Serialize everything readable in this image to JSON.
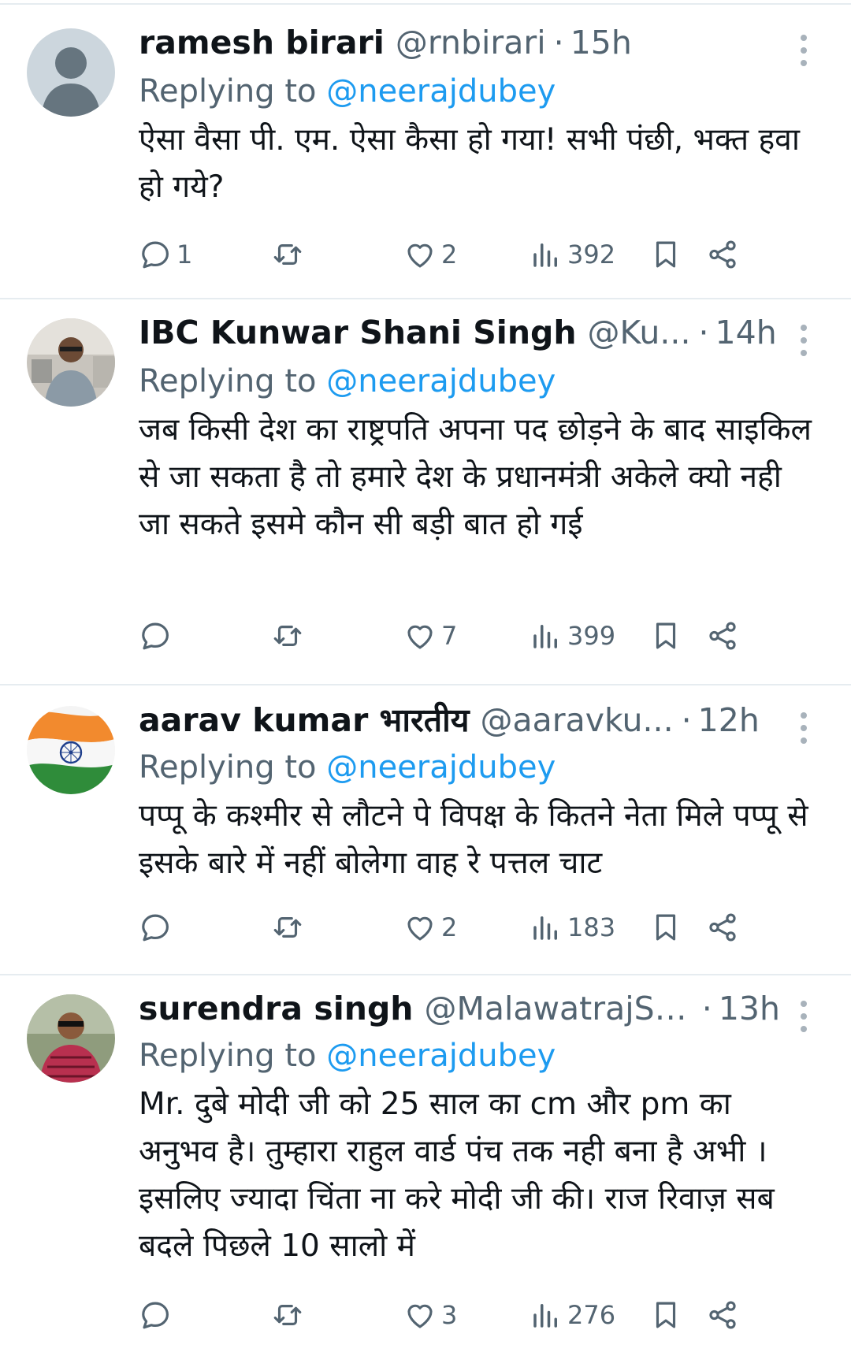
{
  "tweets": [
    {
      "name": "ramesh birari",
      "handle": "@rnbirari",
      "dot": "·",
      "time": "15h",
      "replying_prefix": "Replying to",
      "replying_to": "@neerajdubey",
      "text": "ऐसा वैसा पी. एम. ऐसा  कैसा  हो  गया! सभी पंछी, भक्त हवा हो गये?",
      "replies": "1",
      "retweets": "",
      "likes": "2",
      "views": "392",
      "avatar": "default-person-avatar"
    },
    {
      "name": "IBC Kunwar Shani Singh",
      "handle": "@Ku...",
      "dot": "·",
      "time": "14h",
      "replying_prefix": "Replying to",
      "replying_to": "@neerajdubey",
      "text": "जब किसी देश का राष्ट्रपति अपना पद छोड़ने के बाद साइकिल से जा सकता है तो हमारे देश के प्रधानमंत्री अकेले क्यो नही जा सकते इसमे कौन सी बड़ी बात हो गई",
      "replies": "",
      "retweets": "",
      "likes": "7",
      "views": "399",
      "avatar": "person-photo-avatar"
    },
    {
      "name": "aarav kumar भारतीय",
      "handle": "@aaravku...",
      "dot": "·",
      "time": "12h",
      "replying_prefix": "Replying to",
      "replying_to": "@neerajdubey",
      "text": "पप्पू के कश्मीर से लौटने पे विपक्ष के कितने नेता मिले पप्पू से इसके बारे में नहीं बोलेगा वाह रे पत्तल चाट",
      "replies": "",
      "retweets": "",
      "likes": "2",
      "views": "183",
      "avatar": "indian-flag-avatar"
    },
    {
      "name": "surendra singh",
      "handle": "@MalawatrajSi...",
      "dot": "·",
      "time": "13h",
      "replying_prefix": "Replying to",
      "replying_to": "@neerajdubey",
      "text": "Mr. दुबे मोदी जी को 25 साल का cm और pm का अनुभव है। तुम्हारा राहुल वार्ड पंच तक नही बना है अभी । इसलिए ज्यादा चिंता ना करे मोदी जी की। राज रिवाज़ सब बदले पिछले 10 सालो में",
      "replies": "",
      "retweets": "",
      "likes": "3",
      "views": "276",
      "avatar": "person-photo-avatar"
    }
  ],
  "colors": {
    "text": "#0f1419",
    "secondary": "#536471",
    "link": "#1d9bf0",
    "divider": "#e6ecf0"
  }
}
